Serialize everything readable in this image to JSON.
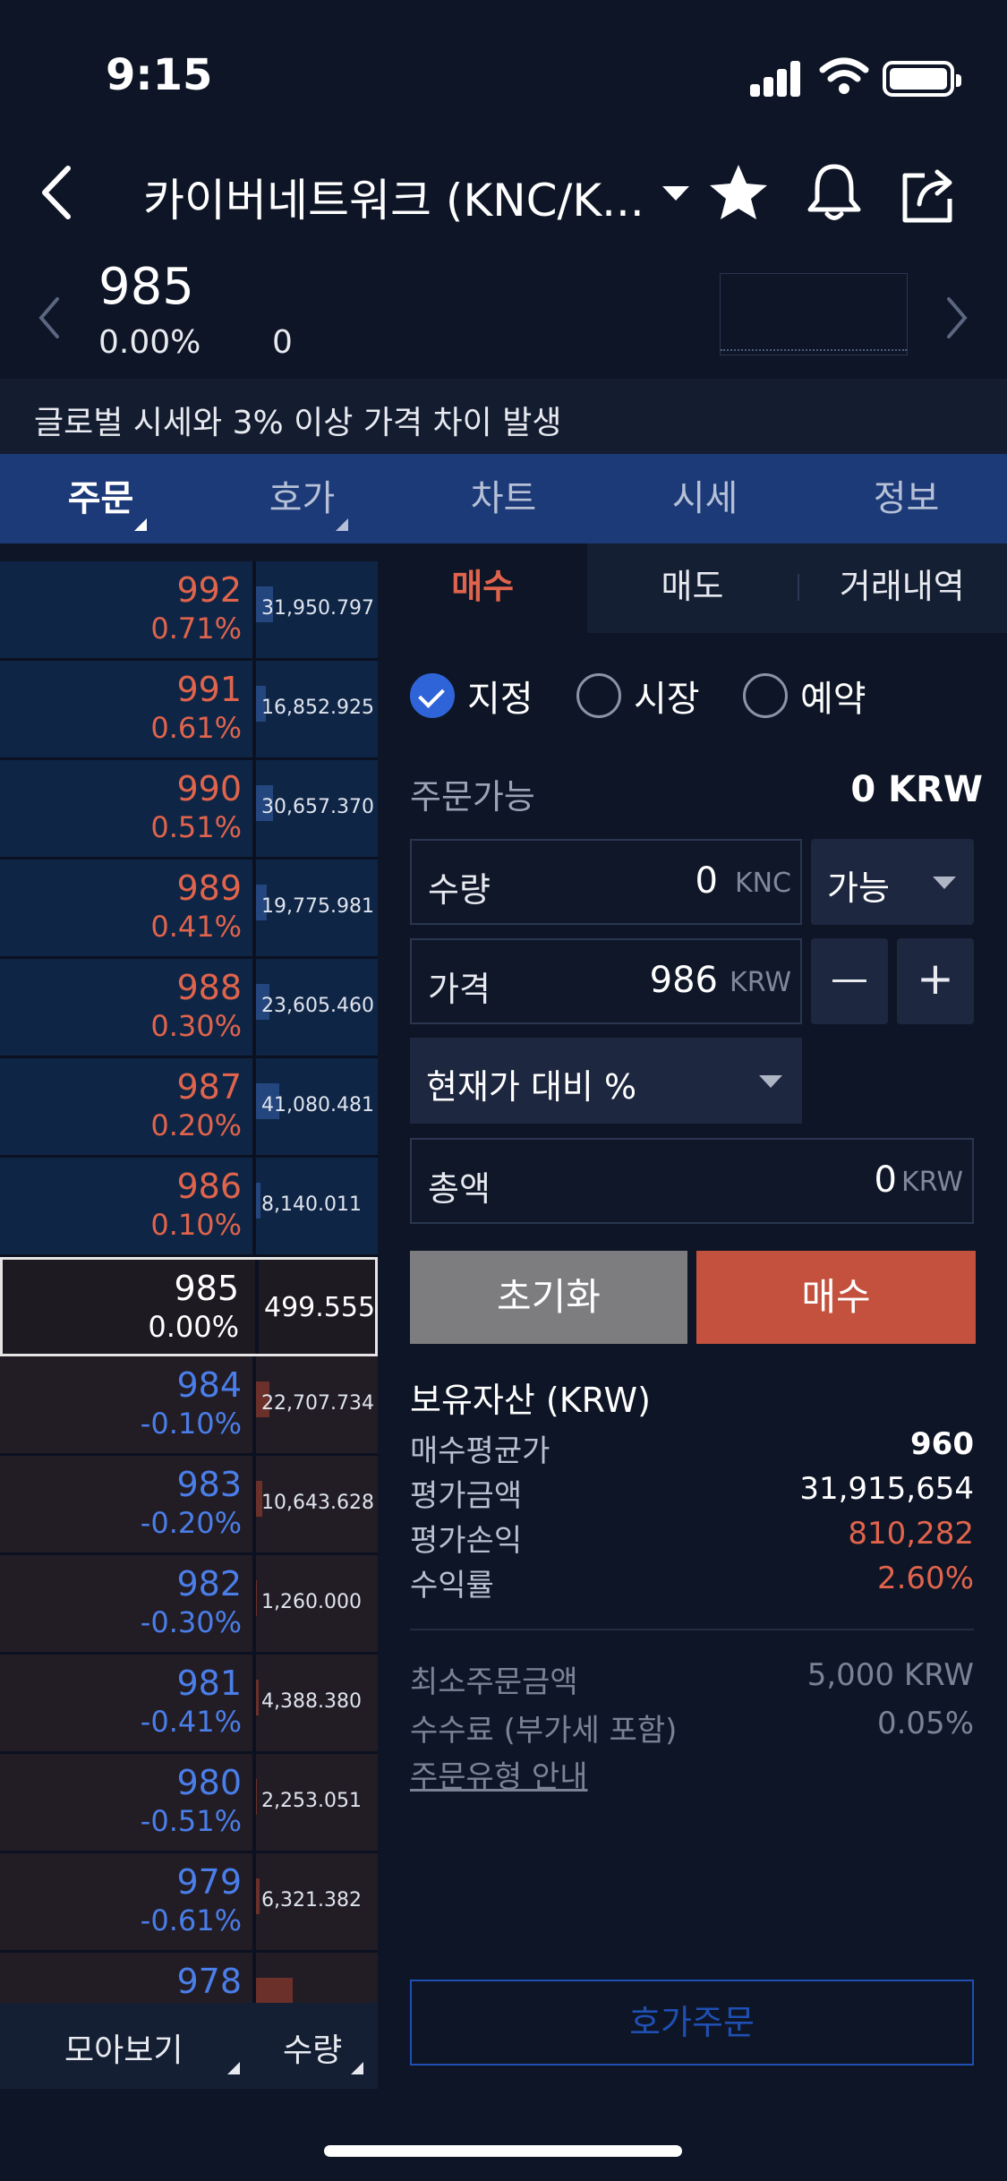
{
  "status": {
    "time": "9:15"
  },
  "header": {
    "title": "카이버네트워크 (KNC/K..."
  },
  "ticker": {
    "price": "985",
    "change_rate": "0.00%",
    "change_value": "0"
  },
  "notice": "글로벌 시세와 3% 이상 가격 차이 발생",
  "tabs": [
    "주문",
    "호가",
    "차트",
    "시세",
    "정보"
  ],
  "orderbook": {
    "rows": [
      {
        "price": "992",
        "pct": "0.71%",
        "qty": "31,950.797",
        "side": "ask",
        "bar": 0.14
      },
      {
        "price": "991",
        "pct": "0.61%",
        "qty": "16,852.925",
        "side": "ask",
        "bar": 0.08
      },
      {
        "price": "990",
        "pct": "0.51%",
        "qty": "30,657.370",
        "side": "ask",
        "bar": 0.14
      },
      {
        "price": "989",
        "pct": "0.41%",
        "qty": "19,775.981",
        "side": "ask",
        "bar": 0.09
      },
      {
        "price": "988",
        "pct": "0.30%",
        "qty": "23,605.460",
        "side": "ask",
        "bar": 0.11
      },
      {
        "price": "987",
        "pct": "0.20%",
        "qty": "41,080.481",
        "side": "ask",
        "bar": 0.19
      },
      {
        "price": "986",
        "pct": "0.10%",
        "qty": "8,140.011",
        "side": "ask",
        "bar": 0.04
      },
      {
        "price": "985",
        "pct": "0.00%",
        "qty": "499.555",
        "side": "current",
        "bar": 0
      },
      {
        "price": "984",
        "pct": "-0.10%",
        "qty": "22,707.734",
        "side": "bid",
        "bar": 0.11
      },
      {
        "price": "983",
        "pct": "-0.20%",
        "qty": "10,643.628",
        "side": "bid",
        "bar": 0.05
      },
      {
        "price": "982",
        "pct": "-0.30%",
        "qty": "1,260.000",
        "side": "bid",
        "bar": 0.01
      },
      {
        "price": "981",
        "pct": "-0.41%",
        "qty": "4,388.380",
        "side": "bid",
        "bar": 0.02
      },
      {
        "price": "980",
        "pct": "-0.51%",
        "qty": "2,253.051",
        "side": "bid",
        "bar": 0.01
      },
      {
        "price": "979",
        "pct": "-0.61%",
        "qty": "6,321.382",
        "side": "bid",
        "bar": 0.03
      },
      {
        "price": "978",
        "pct": "",
        "qty": "",
        "side": "bid",
        "bar": 0.3
      }
    ],
    "footer": {
      "group_label": "모아보기",
      "qty_label": "수량"
    }
  },
  "order": {
    "tabs": [
      "매수",
      "매도",
      "거래내역"
    ],
    "types": [
      "지정",
      "시장",
      "예약"
    ],
    "available_label": "주문가능",
    "available_value": "0 KRW",
    "qty": {
      "label": "수량",
      "value": "0",
      "unit": "KNC",
      "option": "가능"
    },
    "price": {
      "label": "가격",
      "value": "986",
      "unit": "KRW"
    },
    "stepper": {
      "minus": "—",
      "plus": "+"
    },
    "pct_select": "현재가 대비 %",
    "total": {
      "label": "총액",
      "value": "0",
      "unit": "KRW"
    },
    "reset_label": "초기화",
    "buy_label": "매수",
    "holdings": {
      "title": "보유자산 (KRW)",
      "rows": [
        {
          "label": "매수평균가",
          "value": "960"
        },
        {
          "label": "평가금액",
          "value": "31,915,654"
        },
        {
          "label": "평가손익",
          "value": "810,282"
        },
        {
          "label": "수익률",
          "value": "2.60%"
        }
      ]
    },
    "info": [
      {
        "label": "최소주문금액",
        "value": "5,000 KRW"
      },
      {
        "label": "수수료 (부가세 포함)",
        "value": "0.05%"
      }
    ],
    "guide_link": "주문유형 안내",
    "book_order_label": "호가주문"
  }
}
